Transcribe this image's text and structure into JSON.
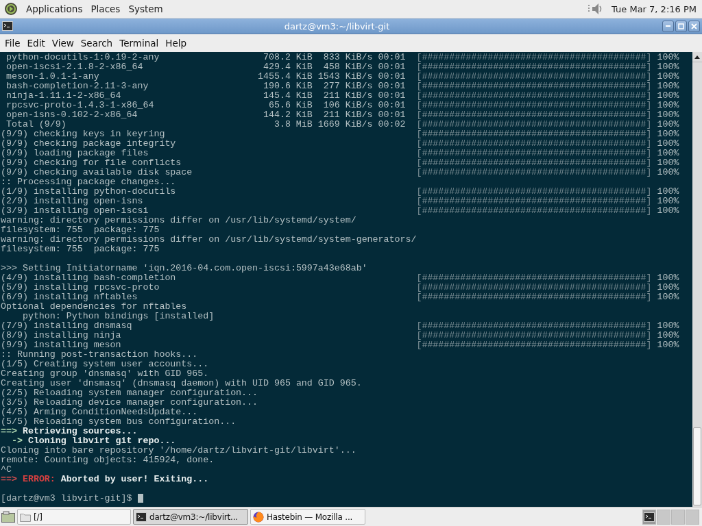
{
  "top_panel": {
    "menus": [
      "Applications",
      "Places",
      "System"
    ],
    "clock": "Tue Mar 7,  2:16 PM"
  },
  "window": {
    "title": "dartz@vm3:~/libvirt-git",
    "menu": [
      "File",
      "Edit",
      "View",
      "Search",
      "Terminal",
      "Help"
    ]
  },
  "terminal": {
    "lines": [
      {
        "kind": "package",
        "name": "python-docutils-1:0.19-2-any",
        "size": "708.2 KiB",
        "rate": "833 KiB/s",
        "time": "00:01",
        "bar": "[#########################################]",
        "percent": "100%"
      },
      {
        "kind": "package",
        "name": "open-iscsi-2.1.8-2-x86_64",
        "size": "429.4 KiB",
        "rate": "458 KiB/s",
        "time": "00:01",
        "bar": "[#########################################]",
        "percent": "100%"
      },
      {
        "kind": "package",
        "name": "meson-1.0.1-1-any",
        "size": "1455.4 KiB",
        "rate": "1543 KiB/s",
        "time": "00:01",
        "bar": "[#########################################]",
        "percent": "100%"
      },
      {
        "kind": "package",
        "name": "bash-completion-2.11-3-any",
        "size": "190.6 KiB",
        "rate": "277 KiB/s",
        "time": "00:01",
        "bar": "[#########################################]",
        "percent": "100%"
      },
      {
        "kind": "package",
        "name": "ninja-1.11.1-2-x86_64",
        "size": "145.4 KiB",
        "rate": "211 KiB/s",
        "time": "00:01",
        "bar": "[#########################################]",
        "percent": "100%"
      },
      {
        "kind": "package",
        "name": "rpcsvc-proto-1.4.3-1-x86_64",
        "size": "65.6 KiB",
        "rate": "106 KiB/s",
        "time": "00:01",
        "bar": "[#########################################]",
        "percent": "100%"
      },
      {
        "kind": "package",
        "name": "open-isns-0.102-2-x86_64",
        "size": "144.2 KiB",
        "rate": "211 KiB/s",
        "time": "00:01",
        "bar": "[#########################################]",
        "percent": "100%"
      },
      {
        "kind": "package",
        "name": "Total (9/9)",
        "size": "3.8 MiB",
        "rate": "1669 KiB/s",
        "time": "00:02",
        "bar": "[#########################################]",
        "percent": "100%"
      },
      {
        "kind": "plain",
        "text": "(9/9) checking keys in keyring",
        "bar": "[#########################################]",
        "percent": "100%"
      },
      {
        "kind": "plain",
        "text": "(9/9) checking package integrity",
        "bar": "[#########################################]",
        "percent": "100%"
      },
      {
        "kind": "plain",
        "text": "(9/9) loading package files",
        "bar": "[#########################################]",
        "percent": "100%"
      },
      {
        "kind": "plain",
        "text": "(9/9) checking for file conflicts",
        "bar": "[#########################################]",
        "percent": "100%"
      },
      {
        "kind": "plain",
        "text": "(9/9) checking available disk space",
        "bar": "[#########################################]",
        "percent": "100%"
      },
      {
        "kind": "plain",
        "text": ":: Processing package changes..."
      },
      {
        "kind": "plain",
        "text": "(1/9) installing python-docutils",
        "bar": "[#########################################]",
        "percent": "100%"
      },
      {
        "kind": "plain",
        "text": "(2/9) installing open-isns",
        "bar": "[#########################################]",
        "percent": "100%"
      },
      {
        "kind": "plain",
        "text": "(3/9) installing open-iscsi",
        "bar": "[#########################################]",
        "percent": "100%"
      },
      {
        "kind": "plain",
        "text": "warning: directory permissions differ on /usr/lib/systemd/system/"
      },
      {
        "kind": "plain",
        "text": "filesystem: 755  package: 775"
      },
      {
        "kind": "plain",
        "text": "warning: directory permissions differ on /usr/lib/systemd/system-generators/"
      },
      {
        "kind": "plain",
        "text": "filesystem: 755  package: 775"
      },
      {
        "kind": "blank"
      },
      {
        "kind": "plain",
        "text": ">>> Setting Initiatorname 'iqn.2016-04.com.open-iscsi:5997a43e68ab'"
      },
      {
        "kind": "plain",
        "text": "(4/9) installing bash-completion",
        "bar": "[#########################################]",
        "percent": "100%"
      },
      {
        "kind": "plain",
        "text": "(5/9) installing rpcsvc-proto",
        "bar": "[#########################################]",
        "percent": "100%"
      },
      {
        "kind": "plain",
        "text": "(6/9) installing nftables",
        "bar": "[#########################################]",
        "percent": "100%"
      },
      {
        "kind": "plain",
        "text": "Optional dependencies for nftables"
      },
      {
        "kind": "plain",
        "text": "    python: Python bindings [installed]"
      },
      {
        "kind": "plain",
        "text": "(7/9) installing dnsmasq",
        "bar": "[#########################################]",
        "percent": "100%"
      },
      {
        "kind": "plain",
        "text": "(8/9) installing ninja",
        "bar": "[#########################################]",
        "percent": "100%"
      },
      {
        "kind": "plain",
        "text": "(9/9) installing meson",
        "bar": "[#########################################]",
        "percent": "100%"
      },
      {
        "kind": "plain",
        "text": ":: Running post-transaction hooks..."
      },
      {
        "kind": "plain",
        "text": "(1/5) Creating system user accounts..."
      },
      {
        "kind": "plain",
        "text": "Creating group 'dnsmasq' with GID 965."
      },
      {
        "kind": "plain",
        "text": "Creating user 'dnsmasq' (dnsmasq daemon) with UID 965 and GID 965."
      },
      {
        "kind": "plain",
        "text": "(2/5) Reloading system manager configuration..."
      },
      {
        "kind": "plain",
        "text": "(3/5) Reloading device manager configuration..."
      },
      {
        "kind": "plain",
        "text": "(4/5) Arming ConditionNeedsUpdate..."
      },
      {
        "kind": "plain",
        "text": "(5/5) Reloading system bus configuration..."
      },
      {
        "kind": "step",
        "arrow": "==>",
        "text": "Retrieving sources..."
      },
      {
        "kind": "step",
        "arrow": "  ->",
        "text": "Cloning libvirt git repo..."
      },
      {
        "kind": "plain",
        "text": "Cloning into bare repository '/home/dartz/libvirt-git/libvirt'..."
      },
      {
        "kind": "plain",
        "text": "remote: Counting objects: 415924, done."
      },
      {
        "kind": "plain",
        "text": "^C"
      },
      {
        "kind": "error",
        "arrow": "==>",
        "label": "ERROR:",
        "text": "Aborted by user! Exiting..."
      },
      {
        "kind": "blank"
      },
      {
        "kind": "prompt",
        "text": "[dartz@vm3 libvirt-git]$ "
      }
    ]
  },
  "taskbar": {
    "tasks": [
      {
        "kind": "folder",
        "label": "[/]",
        "selected": false
      },
      {
        "kind": "terminal",
        "label": "dartz@vm3:~/libvirt...",
        "selected": true
      },
      {
        "kind": "browser",
        "label": "Hastebin — Mozilla ...",
        "selected": false
      }
    ],
    "workspaces": [
      {
        "selected": true
      },
      {
        "selected": false
      },
      {
        "selected": false
      },
      {
        "selected": false
      }
    ]
  }
}
